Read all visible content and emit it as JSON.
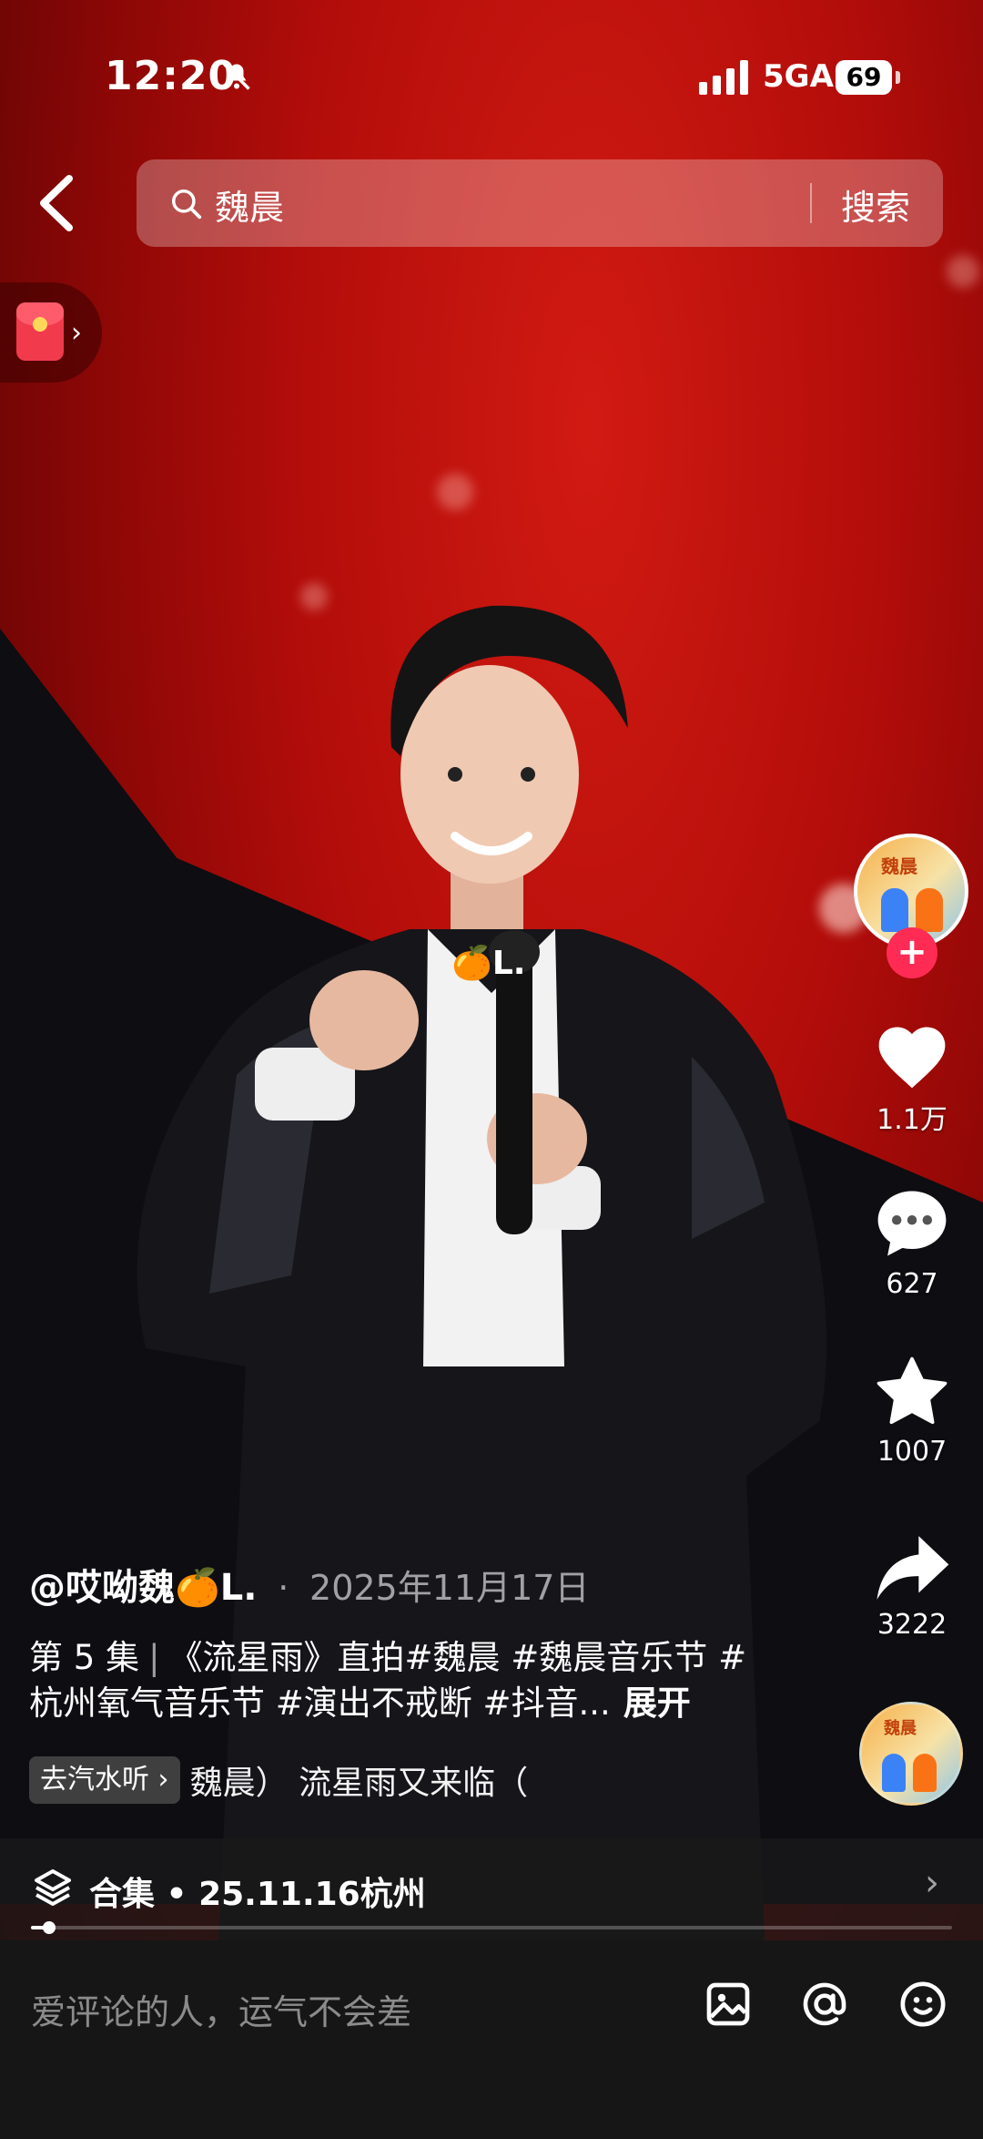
{
  "status_bar": {
    "time": "12:20",
    "network": "5GA",
    "battery": "69"
  },
  "search": {
    "query": "魏晨",
    "button_label": "搜索"
  },
  "actions": {
    "likes": "1.1万",
    "comments": "627",
    "favorites": "1007",
    "shares": "3222"
  },
  "video": {
    "author": "@哎呦魏🍊L.",
    "date_sep": "·",
    "date": "2025年11月17日",
    "episode": "第 5 集",
    "episode_sep": "|",
    "description": "《流星雨》直拍#魏晨 #魏晨音乐节 #杭州氧气音乐节 #演出不戒断 #抖音...",
    "expand_label": "展开",
    "listen_chip": "去汽水听",
    "lyric_text": "魏晨）    流星雨又来临（",
    "overlay_tag": "🍊L.",
    "progress": 0.02
  },
  "collection": {
    "label": "合集 • 25.11.16杭州"
  },
  "comment_bar": {
    "placeholder": "爱评论的人，运气不会差"
  },
  "avatar_text": "魏晨",
  "colors": {
    "accent": "#fe2c55",
    "stage_red": "#c0120c"
  },
  "icons": [
    "mute-icon",
    "signal-icon",
    "back-icon",
    "search-icon",
    "red-packet-icon",
    "plus-icon",
    "heart-icon",
    "comment-icon",
    "star-icon",
    "share-icon",
    "music-disc-icon",
    "layers-icon",
    "chevron-right-icon",
    "image-icon",
    "at-icon",
    "emoji-icon"
  ]
}
